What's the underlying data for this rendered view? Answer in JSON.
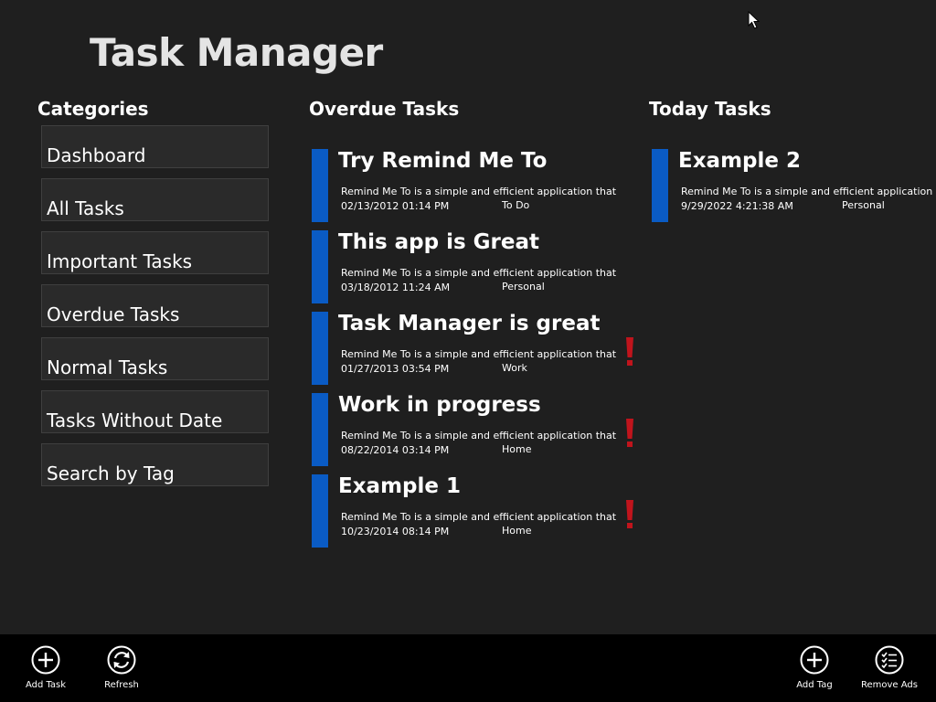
{
  "app": {
    "title": "Task Manager"
  },
  "sections": {
    "categories": "Categories",
    "overdue": "Overdue Tasks",
    "today": "Today Tasks"
  },
  "categories": [
    {
      "label": "Dashboard"
    },
    {
      "label": "All Tasks"
    },
    {
      "label": "Important Tasks"
    },
    {
      "label": "Overdue Tasks"
    },
    {
      "label": "Normal Tasks"
    },
    {
      "label": "Tasks Without Date"
    },
    {
      "label": "Search by Tag"
    }
  ],
  "overdue_tasks": [
    {
      "title": "Try Remind Me To",
      "description": "Remind Me To is a simple and efficient application that a",
      "date": "02/13/2012 01:14 PM",
      "tag": "To Do",
      "important": false
    },
    {
      "title": "This app is Great",
      "description": "Remind Me To is a simple and efficient application that a",
      "date": "03/18/2012 11:24 AM",
      "tag": "Personal",
      "important": false
    },
    {
      "title": "Task Manager is great",
      "description": "Remind Me To is a simple and efficient application that a",
      "date": "01/27/2013 03:54 PM",
      "tag": "Work",
      "important": true
    },
    {
      "title": "Work in progress",
      "description": "Remind Me To is a simple and efficient application that a",
      "date": "08/22/2014 03:14 PM",
      "tag": "Home",
      "important": true
    },
    {
      "title": "Example 1",
      "description": "Remind Me To is a simple and efficient application that a",
      "date": "10/23/2014 08:14 PM",
      "tag": "Home",
      "important": true
    }
  ],
  "today_tasks": [
    {
      "title": "Example 2",
      "description": "Remind Me To is a simple and efficient application th",
      "date": "9/29/2022 4:21:38 AM",
      "tag": "Personal",
      "important": false
    }
  ],
  "app_bar": {
    "add_task": "Add Task",
    "refresh": "Refresh",
    "add_tag": "Add Tag",
    "remove_ads": "Remove Ads"
  },
  "colors": {
    "background": "#1f1f1f",
    "accent": "#0a5bc4",
    "important": "#c0141c",
    "app_bar": "#000000"
  },
  "icons": {
    "add_task": "add-circle-icon",
    "refresh": "refresh-circle-icon",
    "add_tag": "add-circle-icon",
    "remove_ads": "checklist-circle-icon",
    "important": "exclamation-icon"
  }
}
